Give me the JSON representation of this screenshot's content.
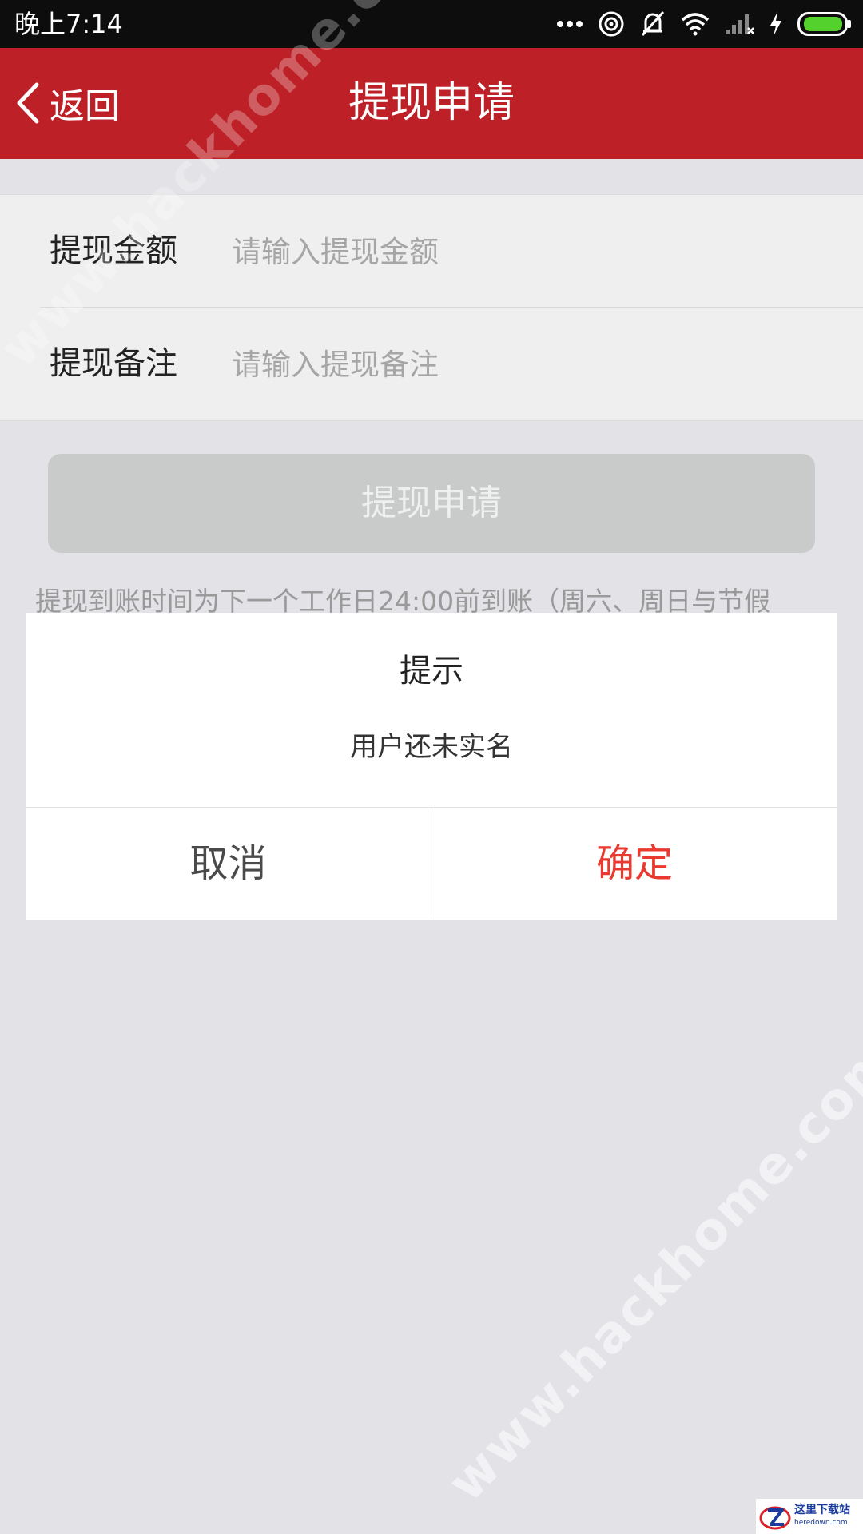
{
  "status_bar": {
    "time": "晚上7:14",
    "icons": [
      "more-dots-icon",
      "hotspot-icon",
      "mute-bell-icon",
      "wifi-icon",
      "signal-no-service-icon",
      "charging-bolt-icon",
      "battery-icon"
    ]
  },
  "header": {
    "back_label": "返回",
    "title": "提现申请",
    "background": "#bd2026"
  },
  "form": {
    "amount": {
      "label": "提现金额",
      "placeholder": "请输入提现金额",
      "value": ""
    },
    "remark": {
      "label": "提现备注",
      "placeholder": "请输入提现备注",
      "value": ""
    }
  },
  "submit_label": "提现申请",
  "note": "提现到账时间为下一个工作日24:00前到账（周六、周日与节假",
  "dialog": {
    "title": "提示",
    "message": "用户还未实名",
    "cancel_label": "取消",
    "confirm_label": "确定",
    "confirm_color": "#e83a2e"
  },
  "watermark": "www.hackhome.com",
  "corner_logo": {
    "name": "这里下载站",
    "domain": "heredown.com"
  }
}
